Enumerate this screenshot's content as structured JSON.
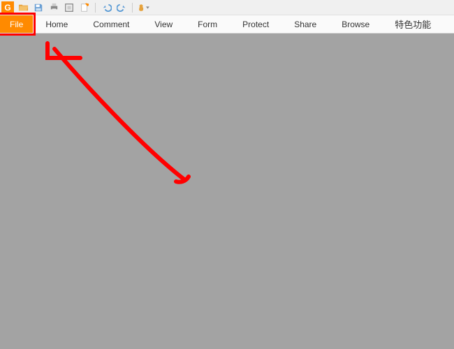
{
  "colors": {
    "accent": "#ff8a00",
    "annotation": "#ff0000",
    "toolbar_bg": "#f0f0f0",
    "menu_bg": "#fafafa",
    "content_bg": "#a3a3a3"
  },
  "quick_toolbar": {
    "app_glyph": "G",
    "icons": [
      "app-logo",
      "folder-open",
      "save",
      "print",
      "scan-snapshot",
      "new-blank",
      "undo",
      "redo",
      "hand-tool"
    ]
  },
  "menu": {
    "file": "File",
    "home": "Home",
    "comment": "Comment",
    "view": "View",
    "form": "Form",
    "protect": "Protect",
    "share": "Share",
    "browse": "Browse",
    "special": "特色功能"
  },
  "annotation": {
    "type": "arrow",
    "target": "file-tab",
    "color": "#ff0000"
  }
}
